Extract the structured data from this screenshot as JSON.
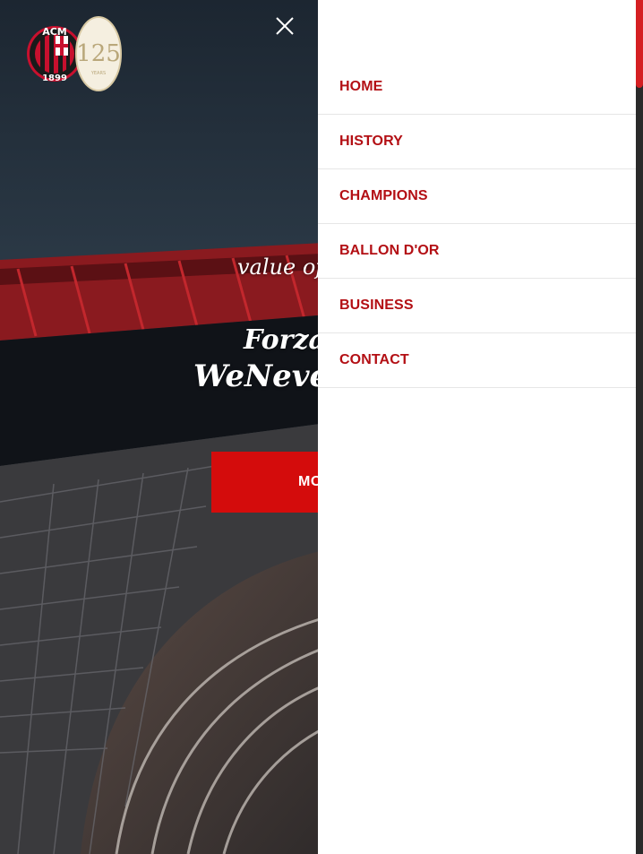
{
  "header": {
    "logo_alt": "ACM 1899",
    "logo_top_text": "ACM",
    "logo_year": "1899",
    "anniversary_number": "125",
    "anniversary_label": "YEARS",
    "close_icon": "close-icon"
  },
  "hero": {
    "line1": "value of F",
    "line2": "Forza",
    "line3": "WeNever",
    "button_label": "MO"
  },
  "menu": {
    "items": [
      {
        "label": "HOME"
      },
      {
        "label": "HISTORY"
      },
      {
        "label": "CHAMPIONS"
      },
      {
        "label": "BALLON D'OR"
      },
      {
        "label": "BUSINESS"
      },
      {
        "label": "CONTACT"
      }
    ]
  },
  "colors": {
    "accent": "#d40c0c",
    "menu_text": "#b30f14",
    "menu_bg": "#ffffff"
  }
}
